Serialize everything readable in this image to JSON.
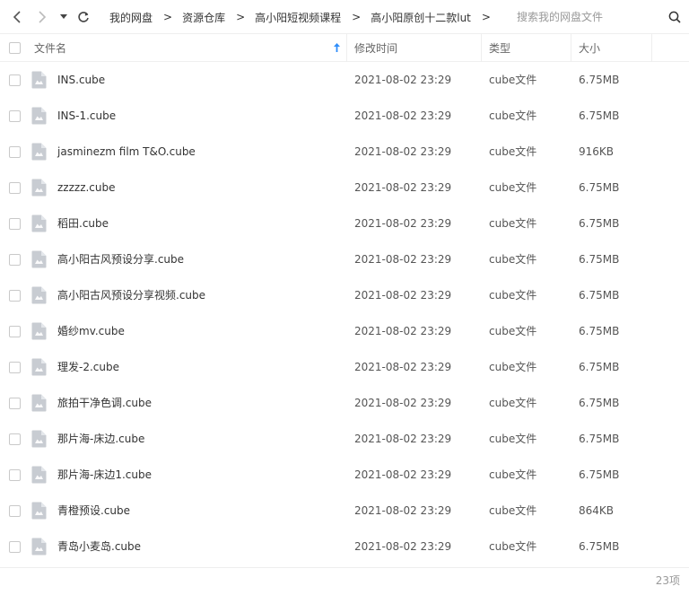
{
  "breadcrumb": [
    "我的网盘",
    "资源仓库",
    "高小阳短视频课程",
    "高小阳原创十二款lut"
  ],
  "breadcrumb_separator": ">",
  "search": {
    "placeholder": "搜索我的网盘文件"
  },
  "columns": {
    "name": "文件名",
    "modified": "修改时间",
    "type": "类型",
    "size": "大小"
  },
  "sort": {
    "column": "name",
    "icon": "sort-up-arrow-icon",
    "color": "#2f8dfa"
  },
  "files": [
    {
      "name": "INS.cube",
      "modified": "2021-08-02 23:29",
      "type": "cube文件",
      "size": "6.75MB"
    },
    {
      "name": "INS-1.cube",
      "modified": "2021-08-02 23:29",
      "type": "cube文件",
      "size": "6.75MB"
    },
    {
      "name": "jasminezm film T&O.cube",
      "modified": "2021-08-02 23:29",
      "type": "cube文件",
      "size": "916KB"
    },
    {
      "name": "zzzzz.cube",
      "modified": "2021-08-02 23:29",
      "type": "cube文件",
      "size": "6.75MB"
    },
    {
      "name": "稻田.cube",
      "modified": "2021-08-02 23:29",
      "type": "cube文件",
      "size": "6.75MB"
    },
    {
      "name": "高小阳古风预设分享.cube",
      "modified": "2021-08-02 23:29",
      "type": "cube文件",
      "size": "6.75MB"
    },
    {
      "name": "高小阳古风预设分享视频.cube",
      "modified": "2021-08-02 23:29",
      "type": "cube文件",
      "size": "6.75MB"
    },
    {
      "name": "婚纱mv.cube",
      "modified": "2021-08-02 23:29",
      "type": "cube文件",
      "size": "6.75MB"
    },
    {
      "name": "理发-2.cube",
      "modified": "2021-08-02 23:29",
      "type": "cube文件",
      "size": "6.75MB"
    },
    {
      "name": "旅拍干净色调.cube",
      "modified": "2021-08-02 23:29",
      "type": "cube文件",
      "size": "6.75MB"
    },
    {
      "name": "那片海-床边.cube",
      "modified": "2021-08-02 23:29",
      "type": "cube文件",
      "size": "6.75MB"
    },
    {
      "name": "那片海-床边1.cube",
      "modified": "2021-08-02 23:29",
      "type": "cube文件",
      "size": "6.75MB"
    },
    {
      "name": "青橙预设.cube",
      "modified": "2021-08-02 23:29",
      "type": "cube文件",
      "size": "864KB"
    },
    {
      "name": "青岛小麦岛.cube",
      "modified": "2021-08-02 23:29",
      "type": "cube文件",
      "size": "6.75MB"
    }
  ],
  "file_icon": "generic-file-icon",
  "footer": {
    "count": "23项"
  }
}
